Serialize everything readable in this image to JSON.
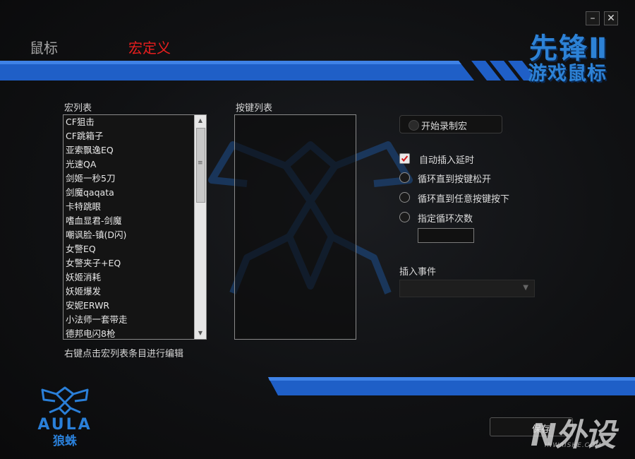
{
  "window": {
    "minimize_glyph": "–",
    "close_glyph": "✕"
  },
  "tabs": [
    {
      "label": "鼠标",
      "active": false
    },
    {
      "label": "宏定义",
      "active": true
    }
  ],
  "brand": {
    "line1": "先锋Ⅱ",
    "line2": "游戏鼠标"
  },
  "macro_list": {
    "label": "宏列表",
    "items": [
      "CF狙击",
      "CF跳箱子",
      "亚索飘逸EQ",
      "光速QA",
      "剑姬一秒5刀",
      "剑魔qaqata",
      "卡特跳眼",
      "嗜血显君-剑魔",
      "嘲讽脸-镇(D闪)",
      "女警EQ",
      "女警夹子+EQ",
      "妖姬消耗",
      "妖姬爆发",
      "安妮ERWR",
      "小法师一套带走",
      "德邦电闪8枪"
    ],
    "hint": "右键点击宏列表条目进行编辑"
  },
  "key_list": {
    "label": "按键列表"
  },
  "record": {
    "label": "开始录制宏"
  },
  "options": [
    {
      "id": "auto-delay",
      "type": "checkbox",
      "checked": true,
      "label": "自动插入延时"
    },
    {
      "id": "loop-until-release",
      "type": "radio",
      "checked": false,
      "label": "循环直到按键松开"
    },
    {
      "id": "loop-until-any-key",
      "type": "radio",
      "checked": false,
      "label": "循环直到任意按键按下"
    },
    {
      "id": "loop-count",
      "type": "radio",
      "checked": false,
      "label": "指定循环次数"
    }
  ],
  "loop_count_value": "",
  "insert_event": {
    "label": "插入事件",
    "selected": ""
  },
  "logo": {
    "text": "AULA",
    "subtext": "狼蛛"
  },
  "save": {
    "label": "保存"
  },
  "watermark": {
    "text": "N外设",
    "subtext": "INWAISHE.COM"
  },
  "colors": {
    "accent_blue": "#1f5fc7",
    "active_tab_red": "#e81e1e",
    "check_red": "#d0191b"
  }
}
